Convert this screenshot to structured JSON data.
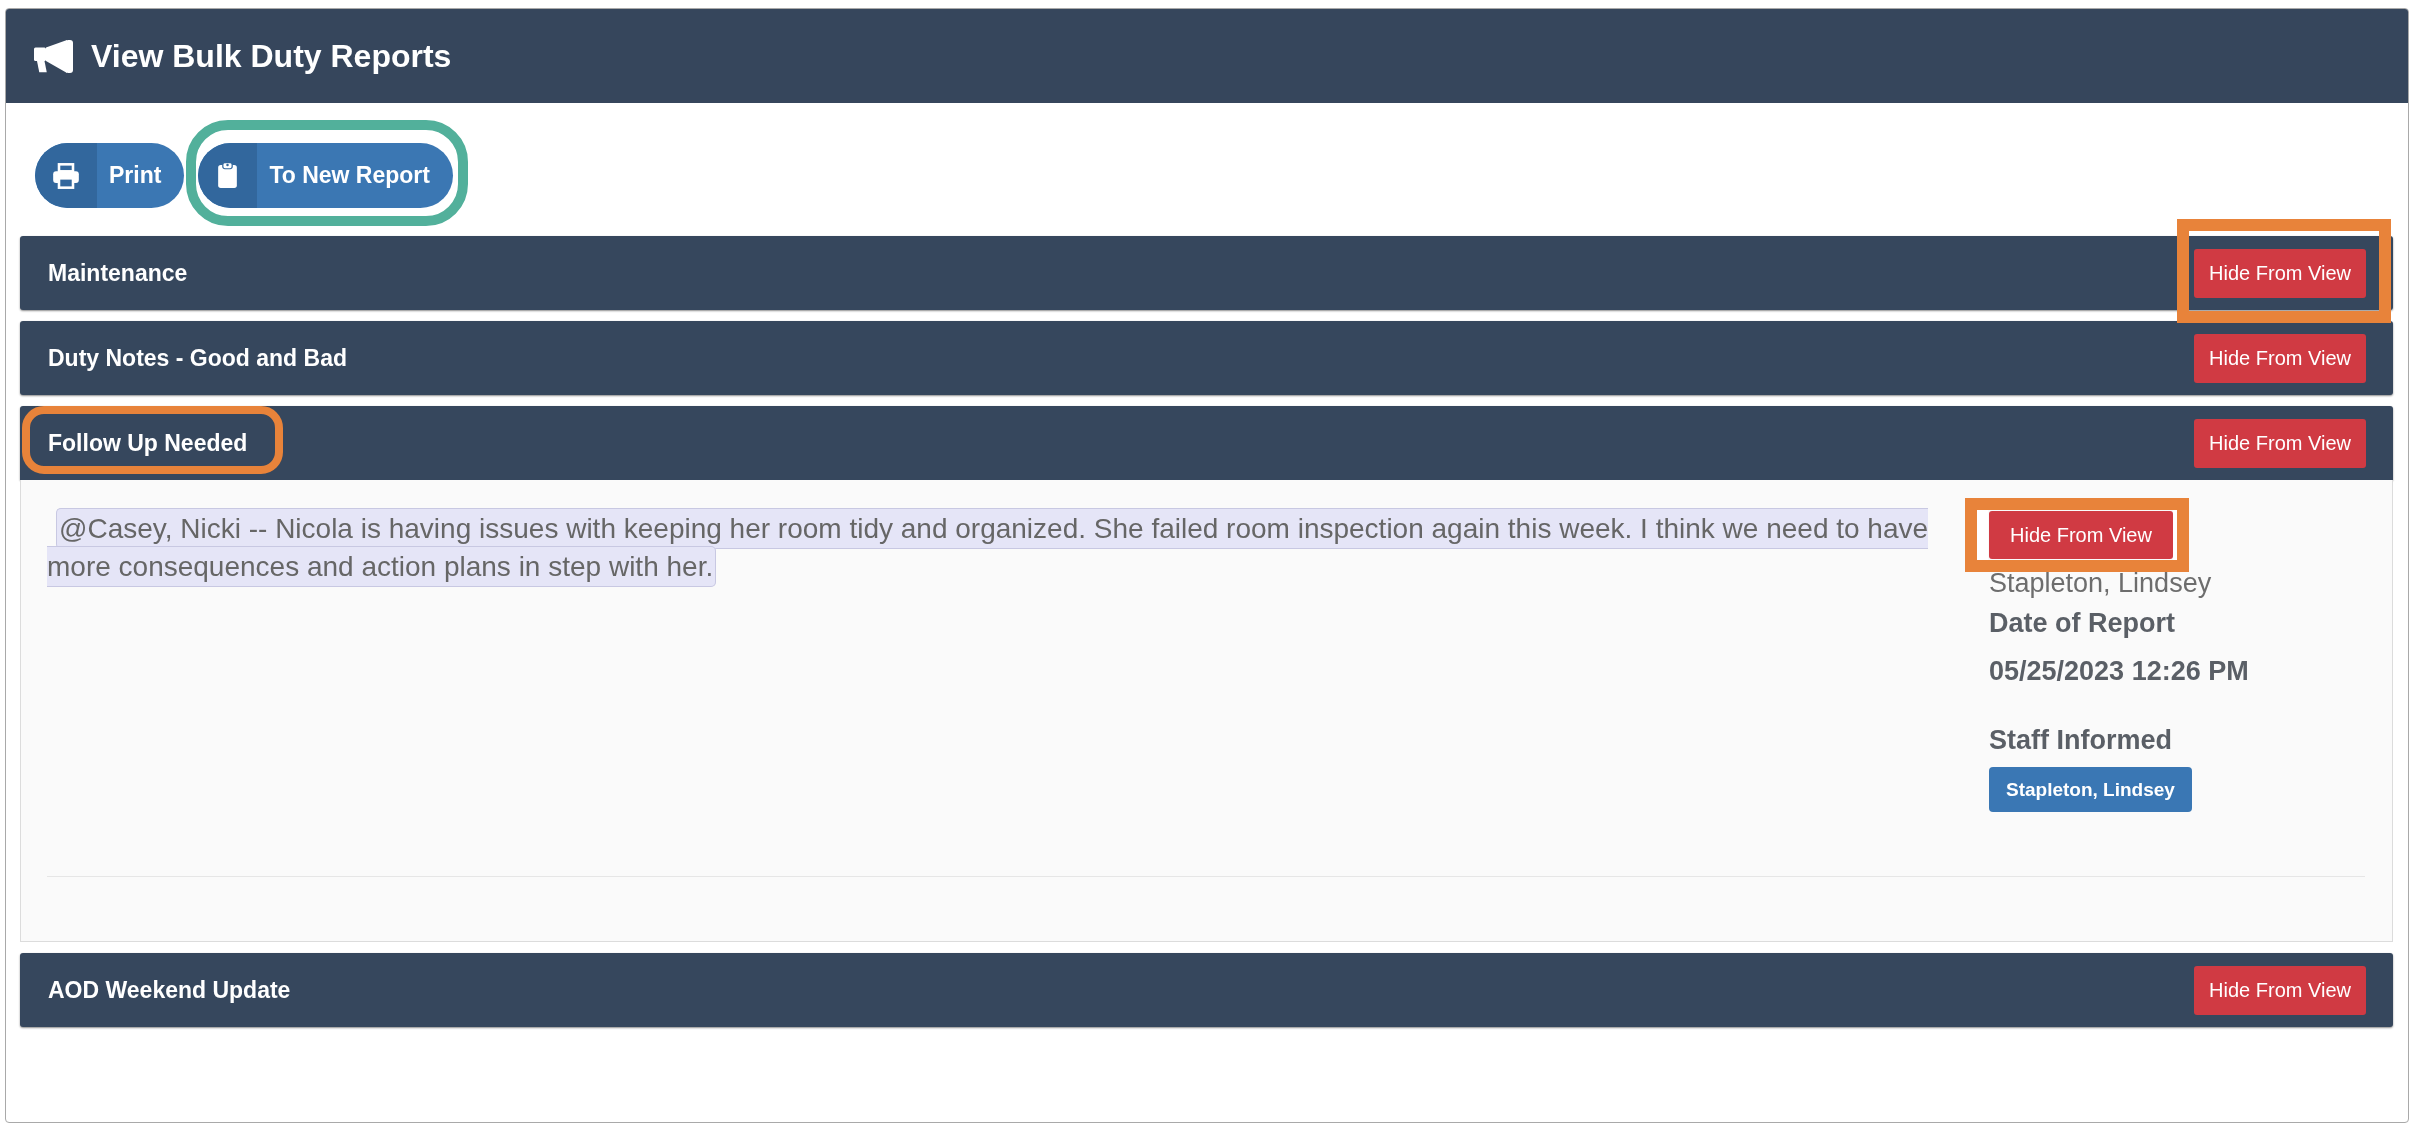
{
  "header": {
    "title": "View Bulk Duty Reports"
  },
  "toolbar": [
    {
      "kind": "print",
      "label": "Print",
      "highlighted": false
    },
    {
      "kind": "transfer",
      "label": "To New Report",
      "highlighted": true
    }
  ],
  "sections": [
    {
      "title": "Maintenance",
      "title_highlighted": false,
      "expanded": false,
      "hide_button": {
        "label": "Hide From View",
        "highlighted": true
      }
    },
    {
      "title": "Duty Notes - Good and Bad",
      "title_highlighted": false,
      "expanded": false,
      "hide_button": {
        "label": "Hide From View",
        "highlighted": false
      }
    },
    {
      "title": "Follow Up Needed",
      "title_highlighted": true,
      "expanded": true,
      "hide_button": {
        "label": "Hide From View",
        "highlighted": false
      },
      "entries": [
        {
          "note": "@Casey, Nicki -- Nicola is having issues with keeping her room tidy and organized. She failed room inspection again this week. I think we need to have more consequences and action plans in step with her.",
          "hide_button": {
            "label": "Hide From View",
            "highlighted": true
          },
          "author": "Stapleton, Lindsey",
          "date_label": "Date of Report",
          "date": "05/25/2023 12:26 PM",
          "staff_label": "Staff Informed",
          "staff_informed": [
            "Stapleton, Lindsey"
          ]
        }
      ]
    },
    {
      "title": "AOD Weekend Update",
      "title_highlighted": false,
      "expanded": false,
      "hide_button": {
        "label": "Hide From View",
        "highlighted": false
      }
    }
  ]
}
